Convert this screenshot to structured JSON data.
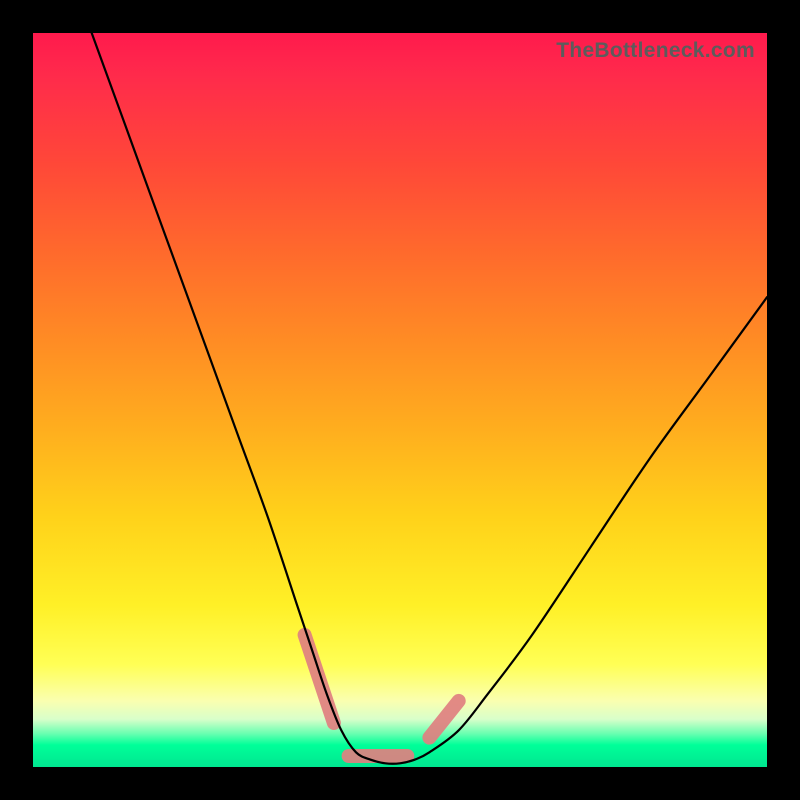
{
  "watermark": "TheBottleneck.com",
  "colors": {
    "frame": "#000000",
    "curve": "#000000",
    "highlight": "#e08080",
    "gradient_top": "#ff1a4d",
    "gradient_bottom": "#00e690"
  },
  "chart_data": {
    "type": "line",
    "title": "",
    "xlabel": "",
    "ylabel": "",
    "xlim": [
      0,
      100
    ],
    "ylim": [
      0,
      100
    ],
    "note": "Axes are unlabeled in the source image; values are in a normalized 0–100 space estimated from pixel positions. y=0 is the top of the plot, y=100 is the bottom.",
    "series": [
      {
        "name": "bottleneck-curve",
        "x": [
          8,
          12,
          16,
          20,
          24,
          28,
          32,
          36,
          38,
          40,
          42,
          44,
          46,
          48,
          50,
          52,
          54,
          58,
          62,
          68,
          76,
          84,
          92,
          100
        ],
        "y": [
          0,
          11,
          22,
          33,
          44,
          55,
          66,
          78,
          84,
          90,
          95,
          98,
          99,
          99.5,
          99.5,
          99,
          98,
          95,
          90,
          82,
          70,
          58,
          47,
          36
        ]
      }
    ],
    "highlight_segments": [
      {
        "name": "left-descent-marker",
        "x": [
          37,
          41
        ],
        "y": [
          82,
          94
        ]
      },
      {
        "name": "valley-floor-marker",
        "x": [
          43,
          51
        ],
        "y": [
          98.5,
          98.5
        ]
      },
      {
        "name": "right-ascent-marker",
        "x": [
          54,
          58
        ],
        "y": [
          96,
          91
        ]
      }
    ]
  }
}
